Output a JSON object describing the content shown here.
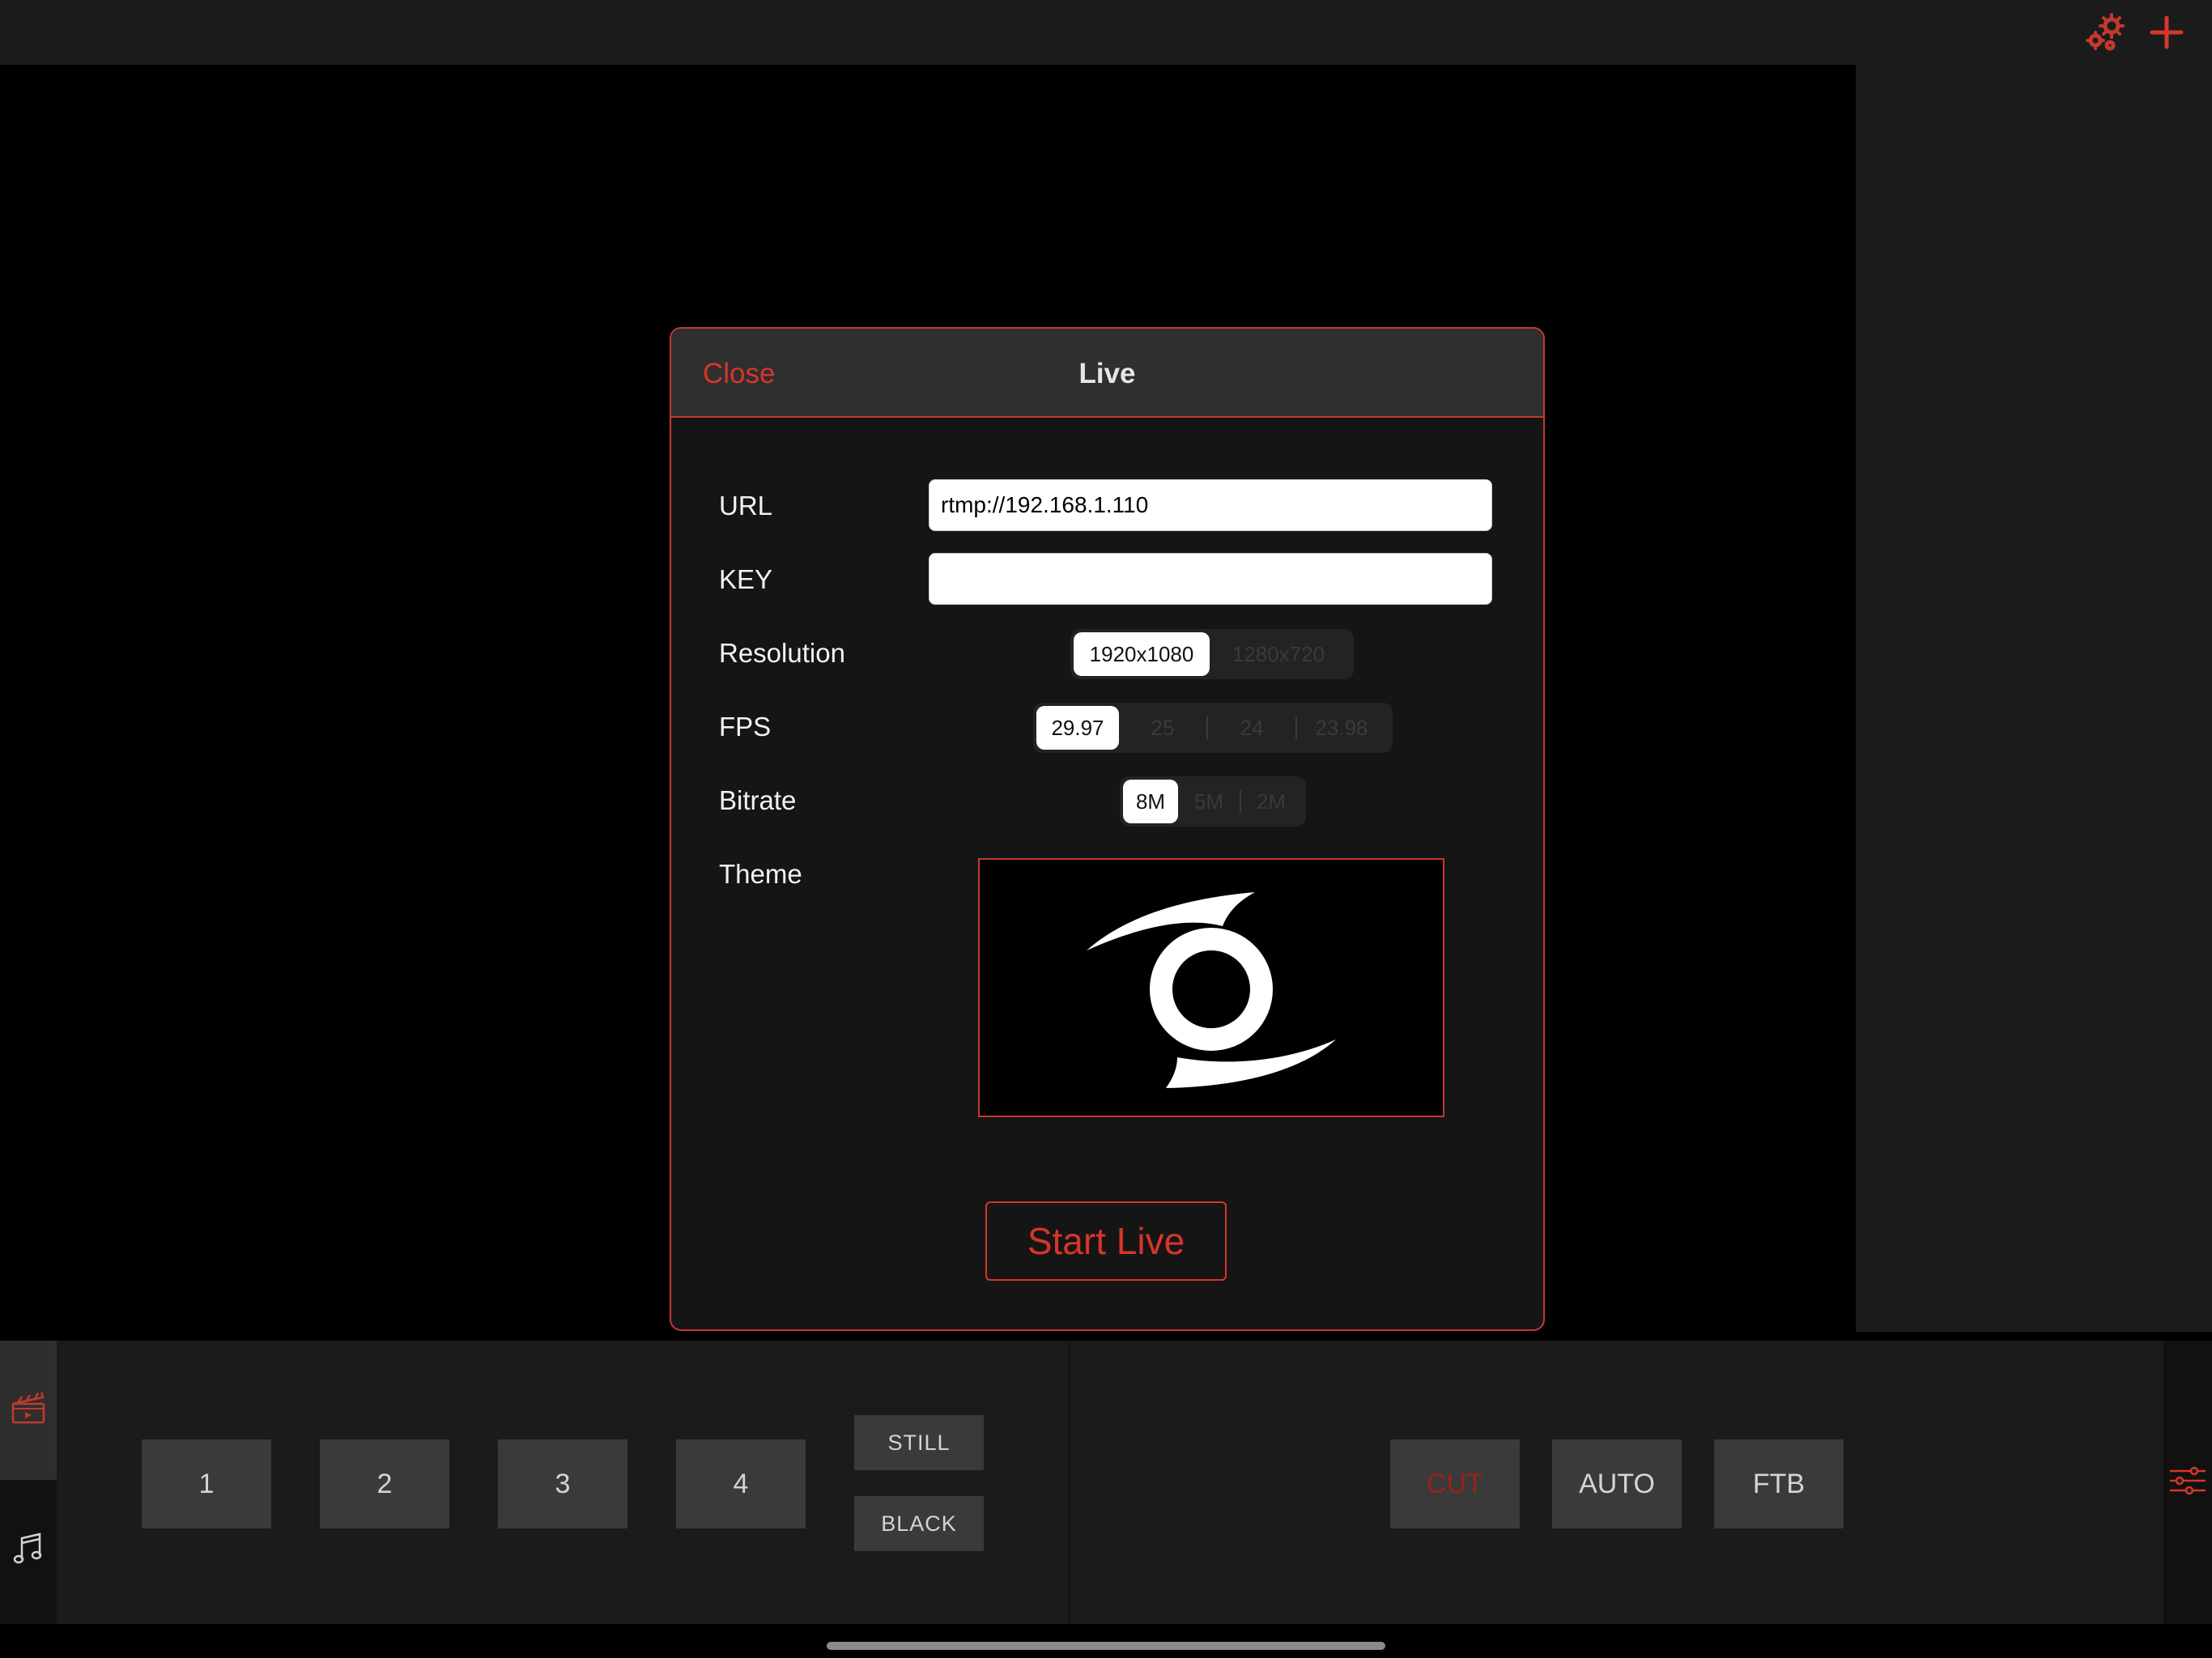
{
  "topbar": {
    "icons": [
      "gears-icon",
      "plus-icon"
    ]
  },
  "modal": {
    "close_label": "Close",
    "title": "Live",
    "url_label": "URL",
    "url_value": "rtmp://192.168.1.110",
    "key_label": "KEY",
    "key_value": "",
    "resolution_label": "Resolution",
    "resolution_options": [
      "1920x1080",
      "1280x720"
    ],
    "resolution_selected": "1920x1080",
    "fps_label": "FPS",
    "fps_options": [
      "29.97",
      "25",
      "24",
      "23.98"
    ],
    "fps_selected": "29.97",
    "bitrate_label": "Bitrate",
    "bitrate_options": [
      "8M",
      "5M",
      "2M"
    ],
    "bitrate_selected": "8M",
    "theme_label": "Theme",
    "start_label": "Start Live"
  },
  "bottom": {
    "tabs": [
      "clapperboard-icon",
      "music-note-icon"
    ],
    "sources": [
      "1",
      "2",
      "3",
      "4"
    ],
    "still_label": "STILL",
    "black_label": "BLACK",
    "cut_label": "CUT",
    "auto_label": "AUTO",
    "ftb_label": "FTB"
  },
  "colors": {
    "accent": "#d6362a",
    "background": "#000000",
    "panel": "#1b1b1b"
  }
}
